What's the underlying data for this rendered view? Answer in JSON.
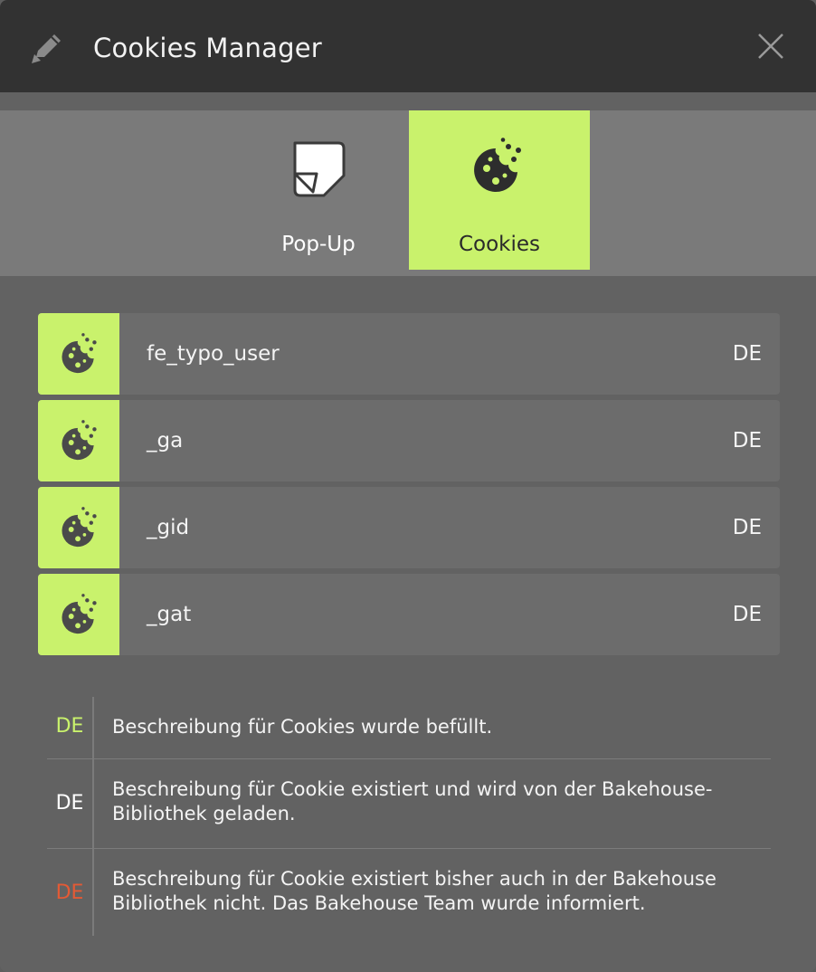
{
  "header": {
    "title": "Cookies Manager",
    "edit_icon": "pencil-icon",
    "close_icon": "close-icon"
  },
  "tabs": [
    {
      "label": "Pop-Up",
      "icon": "sticky-note-icon",
      "active": false
    },
    {
      "label": "Cookies",
      "icon": "cookie-icon",
      "active": true
    }
  ],
  "cookies": [
    {
      "name": "fe_typo_user",
      "lang": "DE"
    },
    {
      "name": "_ga",
      "lang": "DE"
    },
    {
      "name": "_gid",
      "lang": "DE"
    },
    {
      "name": "_gat",
      "lang": "DE"
    }
  ],
  "legend": [
    {
      "code": "DE",
      "color": "#c9f26c",
      "text": "Beschreibung für Cookies wurde befüllt."
    },
    {
      "code": "DE",
      "color": "#ffffff",
      "text": "Beschreibung für Cookie existiert und wird von der Bakehouse-Bibliothek geladen."
    },
    {
      "code": "DE",
      "color": "#e35a35",
      "text": "Beschreibung für Cookie existiert bisher auch in der Bakehouse Bibliothek nicht. Das Bakehouse Team wurde informiert."
    }
  ],
  "colors": {
    "accent": "#c9f26c",
    "header_bg": "#323232",
    "missing": "#e35a35"
  }
}
